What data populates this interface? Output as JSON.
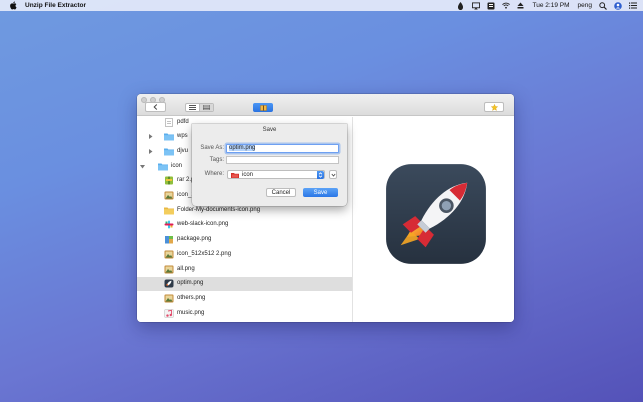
{
  "menubar": {
    "app_name": "Unzip File Extractor",
    "clock": "Tue 2:19 PM",
    "user": "peng",
    "icons": [
      "dropbox-icon",
      "airplay-icon",
      "keyboard-icon",
      "wifi-icon",
      "eject-icon",
      "search-icon",
      "user-badge-icon",
      "list-icon"
    ]
  },
  "toolbar": {
    "back_icon": "chevron-left-icon",
    "view_icons": [
      "list-view-icon",
      "column-view-icon"
    ],
    "favorite_icon": "star-icon"
  },
  "files": [
    {
      "name": "pdfd",
      "icon": "document-icon",
      "indent": 1,
      "disclosure": "",
      "selected": false
    },
    {
      "name": "wps",
      "icon": "folder-icon",
      "indent": 1,
      "disclosure": "collapsed",
      "selected": false
    },
    {
      "name": "djvu",
      "icon": "folder-icon",
      "indent": 1,
      "disclosure": "collapsed",
      "selected": false
    },
    {
      "name": "icon",
      "icon": "folder-icon",
      "indent": 0,
      "disclosure": "expanded",
      "selected": false
    },
    {
      "name": "rar 2.pr",
      "icon": "archive-icon",
      "indent": 1,
      "disclosure": "",
      "selected": false
    },
    {
      "name": "icon_12",
      "icon": "image-icon",
      "indent": 1,
      "disclosure": "",
      "selected": false
    },
    {
      "name": "Folder-My-documents-icon.png",
      "icon": "folder-image-icon",
      "indent": 1,
      "disclosure": "",
      "selected": false
    },
    {
      "name": "web-slack-icon.png",
      "icon": "slack-icon",
      "indent": 1,
      "disclosure": "",
      "selected": false
    },
    {
      "name": "package.png",
      "icon": "package-icon",
      "indent": 1,
      "disclosure": "",
      "selected": false
    },
    {
      "name": "icon_512x512 2.png",
      "icon": "image-icon",
      "indent": 1,
      "disclosure": "",
      "selected": false
    },
    {
      "name": "all.png",
      "icon": "image-icon",
      "indent": 1,
      "disclosure": "",
      "selected": false
    },
    {
      "name": "optim.png",
      "icon": "rocket-icon",
      "indent": 1,
      "disclosure": "",
      "selected": true
    },
    {
      "name": "others.png",
      "icon": "image-icon",
      "indent": 1,
      "disclosure": "",
      "selected": false
    },
    {
      "name": "music.png",
      "icon": "music-icon",
      "indent": 1,
      "disclosure": "",
      "selected": false
    }
  ],
  "save_dialog": {
    "title": "Save",
    "save_as_label": "Save As:",
    "save_as_value": "optim.png",
    "tags_label": "Tags:",
    "tags_value": "",
    "where_label": "Where:",
    "where_value": "icon",
    "cancel_label": "Cancel",
    "save_label": "Save"
  },
  "preview": {
    "icon": "rocket-app-icon"
  },
  "colors": {
    "accent": "#2b77e6",
    "selection": "#dedede",
    "folder": "#6fb6f0"
  }
}
